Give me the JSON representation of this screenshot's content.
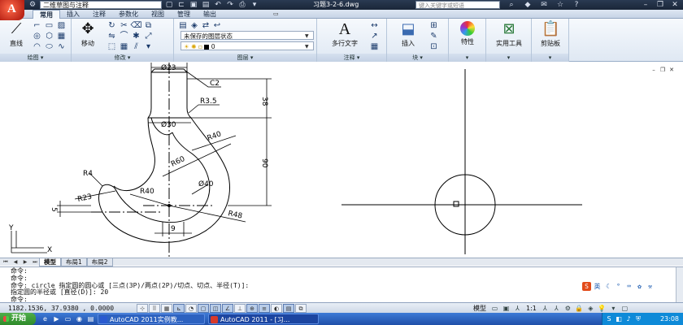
{
  "titlebar": {
    "workspace": "二维草图与注释",
    "document_title": "习题3-2-6.dwg",
    "search_placeholder": "键入关键字或短语"
  },
  "ribbon": {
    "tabs": [
      "常用",
      "插入",
      "注释",
      "参数化",
      "视图",
      "管理",
      "输出"
    ],
    "active_tab": 0,
    "panels": {
      "draw": {
        "label": "绘图",
        "big_button": "直线"
      },
      "modify": {
        "label": "修改",
        "big_button": "移动"
      },
      "layers": {
        "label": "图层",
        "layer_state": "未保存的图层状态",
        "current_layer": "0"
      },
      "annotation": {
        "label": "注释",
        "big_button": "多行文字"
      },
      "block": {
        "label": "块",
        "big_button": "插入"
      },
      "properties": {
        "label": "特性"
      },
      "utilities": {
        "label": "实用工具"
      },
      "clipboard": {
        "label": "剪贴板"
      }
    }
  },
  "drawing": {
    "dimensions": {
      "d23": "Ø23",
      "c2": "C2",
      "r3_5": "R3.5",
      "v38": "38",
      "d30": "Ø30",
      "r40_top": "R40",
      "r60": "R60",
      "v90": "90",
      "r4": "R4",
      "r23": "R23",
      "r40_mid": "R40",
      "d40": "Ø40",
      "v5": "5",
      "r48": "R48",
      "h9": "9"
    },
    "ucs": {
      "x": "X",
      "y": "Y"
    }
  },
  "layout_tabs": [
    "模型",
    "布局1",
    "布局2"
  ],
  "command_line": {
    "lines": [
      "命令:",
      "命令:",
      "命令:  circle 指定圆的圆心或 [三点(3P)/两点(2P)/切点、切点、半径(T)]:",
      "指定圆的半径或 [直径(D)]: 20",
      "命令:"
    ]
  },
  "statusbar": {
    "coordinates": "1182.1536,  37.9380 ,  0.0000",
    "model_label": "模型",
    "annotation_scale": "1:1"
  },
  "taskbar": {
    "start": "开始",
    "tasks": [
      "AutoCAD 2011实例教...",
      "AutoCAD 2011 - [习..."
    ],
    "clock": "23:08"
  }
}
